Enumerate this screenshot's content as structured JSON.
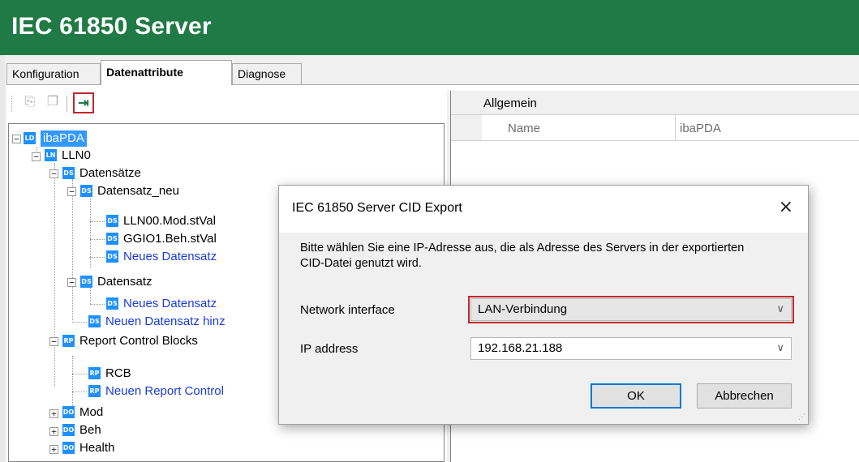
{
  "app": {
    "title": "IEC 61850 Server"
  },
  "tabs": [
    {
      "label": "Konfiguration"
    },
    {
      "label": "Datenattribute"
    },
    {
      "label": "Diagnose"
    }
  ],
  "toolbar": {
    "copy_icon": "copy-icon",
    "paste_icon": "paste-icon",
    "export_icon": "export-icon",
    "export_color": "#1f7a45",
    "highlight_color": "#c0282f"
  },
  "tree": {
    "badges": {
      "ld": "LD",
      "ln": "LN",
      "ds": "DS",
      "rp": "RP",
      "do": "DO"
    },
    "root": "ibaPDA",
    "lln0": "LLN0",
    "datensaetze": "Datensätze",
    "datensatz_neu": "Datensatz_neu",
    "item1": "LLN00.Mod.stVal",
    "item2": "GGIO1.Beh.stVal",
    "neues_ds_1": "Neues Datensatz",
    "datensatz": "Datensatz",
    "neues_ds_2": "Neues Datensatz",
    "neuen_ds": "Neuen Datensatz hinz",
    "rcb_group": "Report Control Blocks",
    "rcb": "RCB",
    "neuen_rcb": "Neuen Report Control",
    "mod": "Mod",
    "beh": "Beh",
    "health": "Health"
  },
  "properties": {
    "group": "Allgemein",
    "name_key": "Name",
    "name_value": "ibaPDA"
  },
  "dialog": {
    "title": "IEC 61850 Server CID Export",
    "close": "×",
    "message": "Bitte wählen Sie eine IP-Adresse aus, die als Adresse des Servers in der exportierten CID-Datei genutzt wird.",
    "network_label": "Network interface",
    "network_value": "LAN-Verbindung",
    "ip_label": "IP address",
    "ip_value": "192.168.21.188",
    "ok": "OK",
    "cancel": "Abbrechen"
  }
}
